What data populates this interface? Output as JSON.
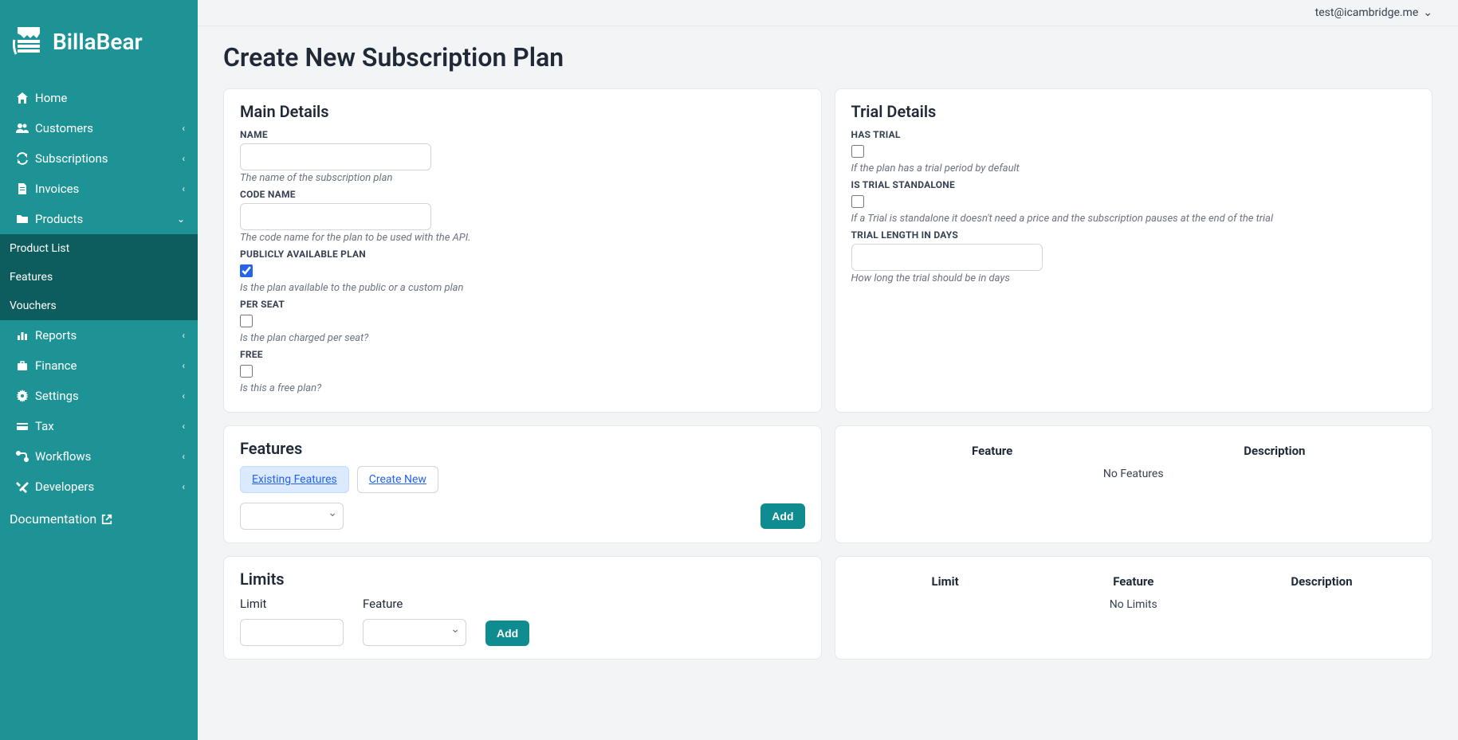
{
  "brand": "BillaBear",
  "user": {
    "email": "test@icambridge.me"
  },
  "sidebar": {
    "items": [
      {
        "label": "Home",
        "expandable": false
      },
      {
        "label": "Customers",
        "expandable": true
      },
      {
        "label": "Subscriptions",
        "expandable": true
      },
      {
        "label": "Invoices",
        "expandable": true
      },
      {
        "label": "Products",
        "expandable": true,
        "expanded": true,
        "sub": [
          {
            "label": "Product List"
          },
          {
            "label": "Features"
          },
          {
            "label": "Vouchers"
          }
        ]
      },
      {
        "label": "Reports",
        "expandable": true
      },
      {
        "label": "Finance",
        "expandable": true
      },
      {
        "label": "Settings",
        "expandable": true
      },
      {
        "label": "Tax",
        "expandable": true
      },
      {
        "label": "Workflows",
        "expandable": true
      },
      {
        "label": "Developers",
        "expandable": true
      }
    ],
    "documentation_label": "Documentation"
  },
  "page": {
    "title": "Create New Subscription Plan",
    "main_details": {
      "heading": "Main Details",
      "name_label": "NAME",
      "name_help": "The name of the subscription plan",
      "code_label": "CODE NAME",
      "code_help": "The code name for the plan to be used with the API.",
      "public_label": "PUBLICLY AVAILABLE PLAN",
      "public_help": "Is the plan available to the public or a custom plan",
      "public_checked": true,
      "perseat_label": "PER SEAT",
      "perseat_help": "Is the plan charged per seat?",
      "perseat_checked": false,
      "free_label": "FREE",
      "free_help": "Is this a free plan?",
      "free_checked": false
    },
    "trial_details": {
      "heading": "Trial Details",
      "hastrial_label": "HAS TRIAL",
      "hastrial_help": "If the plan has a trial period by default",
      "hastrial_checked": false,
      "standalone_label": "IS TRIAL STANDALONE",
      "standalone_help": "If a Trial is standalone it doesn't need a price and the subscription pauses at the end of the trial",
      "standalone_checked": false,
      "length_label": "TRIAL LENGTH IN DAYS",
      "length_help": "How long the trial should be in days"
    },
    "features": {
      "heading": "Features",
      "tab_existing": "Existing Features",
      "tab_create": "Create New",
      "add_button": "Add",
      "col_feature": "Feature",
      "col_description": "Description",
      "empty": "No Features"
    },
    "limits": {
      "heading": "Limits",
      "col_limit": "Limit",
      "col_feature": "Feature",
      "col_description": "Description",
      "empty": "No Limits",
      "limit_label": "Limit",
      "feature_label": "Feature",
      "add_button": "Add"
    }
  }
}
